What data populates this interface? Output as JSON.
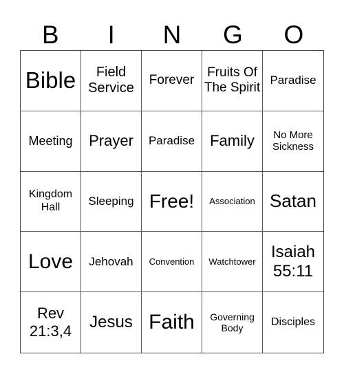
{
  "title_letters": [
    "B",
    "I",
    "N",
    "G",
    "O"
  ],
  "cells": [
    [
      "Bible",
      "Field Service",
      "Forever",
      "Fruits Of The Spirit",
      "Paradise"
    ],
    [
      "Meeting",
      "Prayer",
      "Paradise",
      "Family",
      "No More Sickness"
    ],
    [
      "Kingdom Hall",
      "Sleeping",
      "Free!",
      "Association",
      "Satan"
    ],
    [
      "Love",
      "Jehovah",
      "Convention",
      "Watchtower",
      "Isaiah 55:11"
    ],
    [
      "Rev 21:3,4",
      "Jesus",
      "Faith",
      "Governing Body",
      "Disciples"
    ]
  ]
}
